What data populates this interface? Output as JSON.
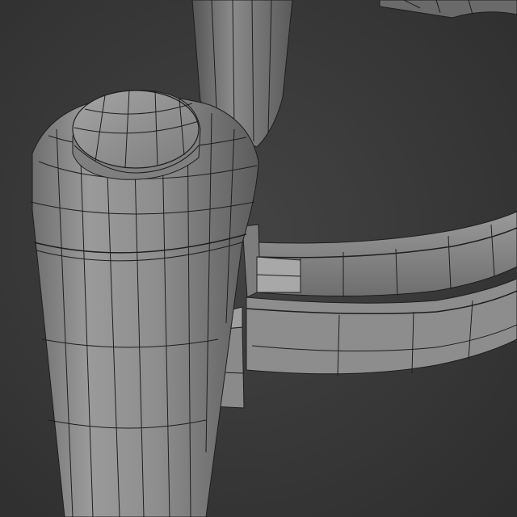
{
  "scene": {
    "kind": "3d-viewport-wireframe-on-shaded",
    "background_color": "#3b3b3b",
    "surface_color": "#8c8c8c",
    "wire_color": "#1e1e1e",
    "objects": [
      "front-cylinder-post",
      "rear-cylinder-post",
      "cylinder-cap",
      "ring-band",
      "clamp-connector"
    ]
  }
}
